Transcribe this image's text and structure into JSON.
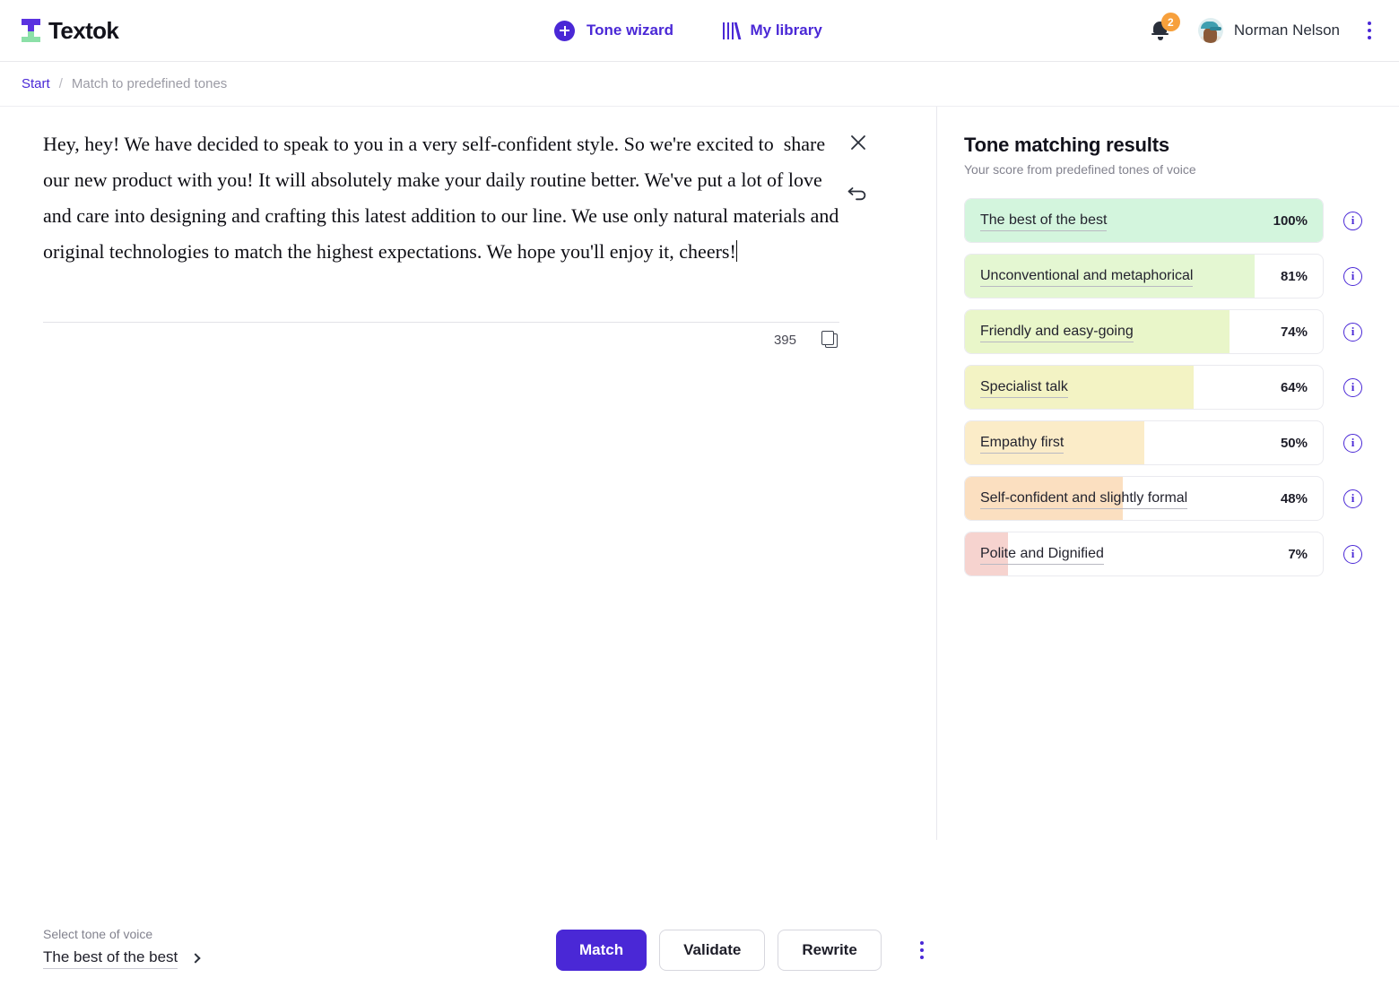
{
  "brand": {
    "name": "Textok",
    "mark_colors": [
      "#5b32e0",
      "#8ce0a8"
    ]
  },
  "header": {
    "nav": [
      {
        "label": "Tone wizard",
        "icon": "plus-circle-icon"
      },
      {
        "label": "My library",
        "icon": "library-books-icon"
      }
    ],
    "notifications": {
      "count": "2",
      "badge_color": "#f7a03c",
      "icon": "bell-icon"
    },
    "user": {
      "name": "Norman Nelson",
      "avatar": "user-avatar"
    },
    "menu_icon": "kebab-menu-icon"
  },
  "breadcrumb": {
    "root": "Start",
    "separator": "/",
    "current": "Match to predefined tones"
  },
  "editor": {
    "text": "Hey, hey! We have decided to speak to you in a very self-confident style. So we're excited to  share our new product with you! It will absolutely make your daily routine better. We've put a lot of love and care into designing and crafting this latest addition to our line. We use only natural materials and original technologies to match the highest expectations. We hope you'll enjoy it, cheers!",
    "char_count": "395",
    "close_icon": "close-icon",
    "undo_icon": "undo-icon",
    "copy_icon": "copy-icon"
  },
  "results": {
    "title": "Tone matching results",
    "subtitle": "Your score from predefined tones of voice",
    "info_icon_label": "i",
    "accent_color": "#4a28d6",
    "rows": [
      {
        "label": "The best of the best",
        "percent": "100%",
        "value": 100,
        "color": "#d3f5dd"
      },
      {
        "label": "Unconventional and metaphorical",
        "percent": "81%",
        "value": 81,
        "color": "#e4f7d2"
      },
      {
        "label": "Friendly and easy-going",
        "percent": "74%",
        "value": 74,
        "color": "#e9f6c9"
      },
      {
        "label": "Specialist talk",
        "percent": "64%",
        "value": 64,
        "color": "#f3f3c4"
      },
      {
        "label": "Empathy first",
        "percent": "50%",
        "value": 50,
        "color": "#fbecc8"
      },
      {
        "label": "Self-confident and slightly formal",
        "percent": "48%",
        "value": 44,
        "color": "#fbdfc0"
      },
      {
        "label": "Polite and Dignified",
        "percent": "7%",
        "value": 12,
        "color": "#f6d3cf"
      }
    ]
  },
  "footer": {
    "tone_select_label": "Select tone of voice",
    "tone_select_value": "The best of the best",
    "buttons": [
      {
        "label": "Match",
        "style": "primary"
      },
      {
        "label": "Validate",
        "style": "ghost"
      },
      {
        "label": "Rewrite",
        "style": "ghost"
      }
    ],
    "more_icon": "kebab-menu-icon"
  }
}
